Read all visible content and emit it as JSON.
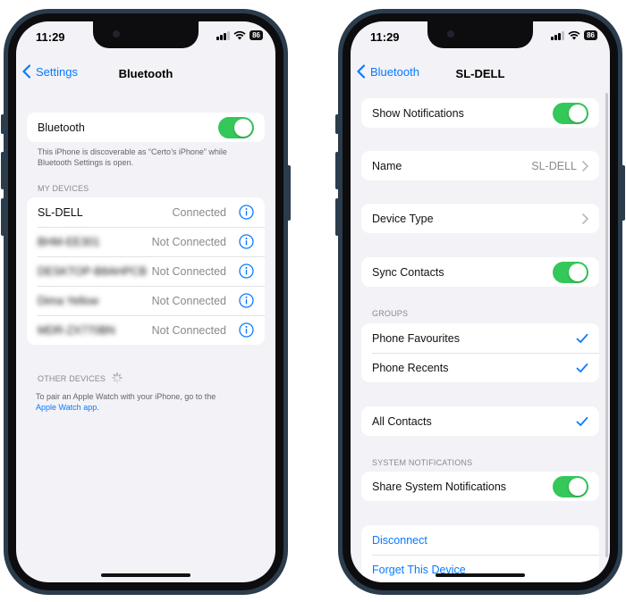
{
  "left": {
    "status": {
      "time": "11:29",
      "battery": "86"
    },
    "nav": {
      "back": "Settings",
      "title": "Bluetooth"
    },
    "bluetooth_label": "Bluetooth",
    "bluetooth_on": true,
    "discover_text_1": "This iPhone is discoverable as “Certo’s iPhone” while",
    "discover_text_2": "Bluetooth Settings is open.",
    "my_devices_header": "MY DEVICES",
    "devices": [
      {
        "name": "SL-DELL",
        "status": "Connected"
      },
      {
        "name": "BHM-EE301",
        "status": "Not Connected"
      },
      {
        "name": "DESKTOP-B8AHPCB",
        "status": "Not Connected"
      },
      {
        "name": "Dima Yellow",
        "status": "Not Connected"
      },
      {
        "name": "MDR-ZX770BN",
        "status": "Not Connected"
      }
    ],
    "other_devices_header": "OTHER DEVICES",
    "pair_text_1": "To pair an Apple Watch with your iPhone, go to the",
    "pair_link": "Apple Watch app."
  },
  "right": {
    "status": {
      "time": "11:29",
      "battery": "86"
    },
    "nav": {
      "back": "Bluetooth",
      "title": "SL-DELL"
    },
    "show_notifications": {
      "label": "Show Notifications",
      "on": true
    },
    "name": {
      "label": "Name",
      "value": "SL-DELL"
    },
    "device_type": {
      "label": "Device Type"
    },
    "sync_contacts": {
      "label": "Sync Contacts",
      "on": true
    },
    "groups_header": "GROUPS",
    "groups": [
      {
        "label": "Phone Favourites",
        "checked": true
      },
      {
        "label": "Phone Recents",
        "checked": true
      }
    ],
    "all_contacts": {
      "label": "All Contacts",
      "checked": true
    },
    "system_notifications_header": "SYSTEM NOTIFICATIONS",
    "share_system_notifications": {
      "label": "Share System Notifications",
      "on": true
    },
    "disconnect": "Disconnect",
    "forget": "Forget This Device"
  },
  "colors": {
    "accent": "#0a7aff",
    "toggle_on": "#34c759",
    "background": "#f2f2f7",
    "frame": "#2b3c4c"
  }
}
